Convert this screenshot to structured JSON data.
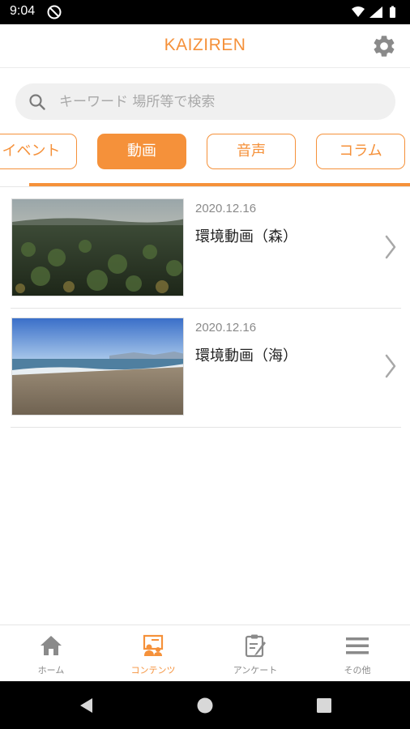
{
  "status_bar": {
    "time": "9:04",
    "icons": [
      "do-not-disturb-icon",
      "wifi-icon",
      "cellular-signal-icon",
      "battery-icon"
    ]
  },
  "header": {
    "title": "KAIZIREN",
    "settings_icon": "gear-icon"
  },
  "search": {
    "placeholder": "キーワード 場所等で検索",
    "value": ""
  },
  "tabs": [
    {
      "label": "イベント",
      "active": false
    },
    {
      "label": "動画",
      "active": true
    },
    {
      "label": "音声",
      "active": false
    },
    {
      "label": "コラム",
      "active": false
    }
  ],
  "videos": [
    {
      "date": "2020.12.16",
      "title": "環境動画（森）",
      "thumbnail": "forest-thumbnail"
    },
    {
      "date": "2020.12.16",
      "title": "環境動画（海）",
      "thumbnail": "beach-thumbnail"
    }
  ],
  "bottom_nav": [
    {
      "label": "ホーム",
      "icon": "home-icon",
      "active": false
    },
    {
      "label": "コンテンツ",
      "icon": "contents-icon",
      "active": true
    },
    {
      "label": "アンケート",
      "icon": "survey-icon",
      "active": false
    },
    {
      "label": "その他",
      "icon": "menu-icon",
      "active": false
    }
  ],
  "system_nav": [
    "back-icon",
    "home-circle-icon",
    "recents-icon"
  ],
  "colors": {
    "accent": "#f5913a",
    "text_primary": "#222222",
    "text_secondary": "#8a8a8a",
    "search_bg": "#f0f0f0"
  }
}
